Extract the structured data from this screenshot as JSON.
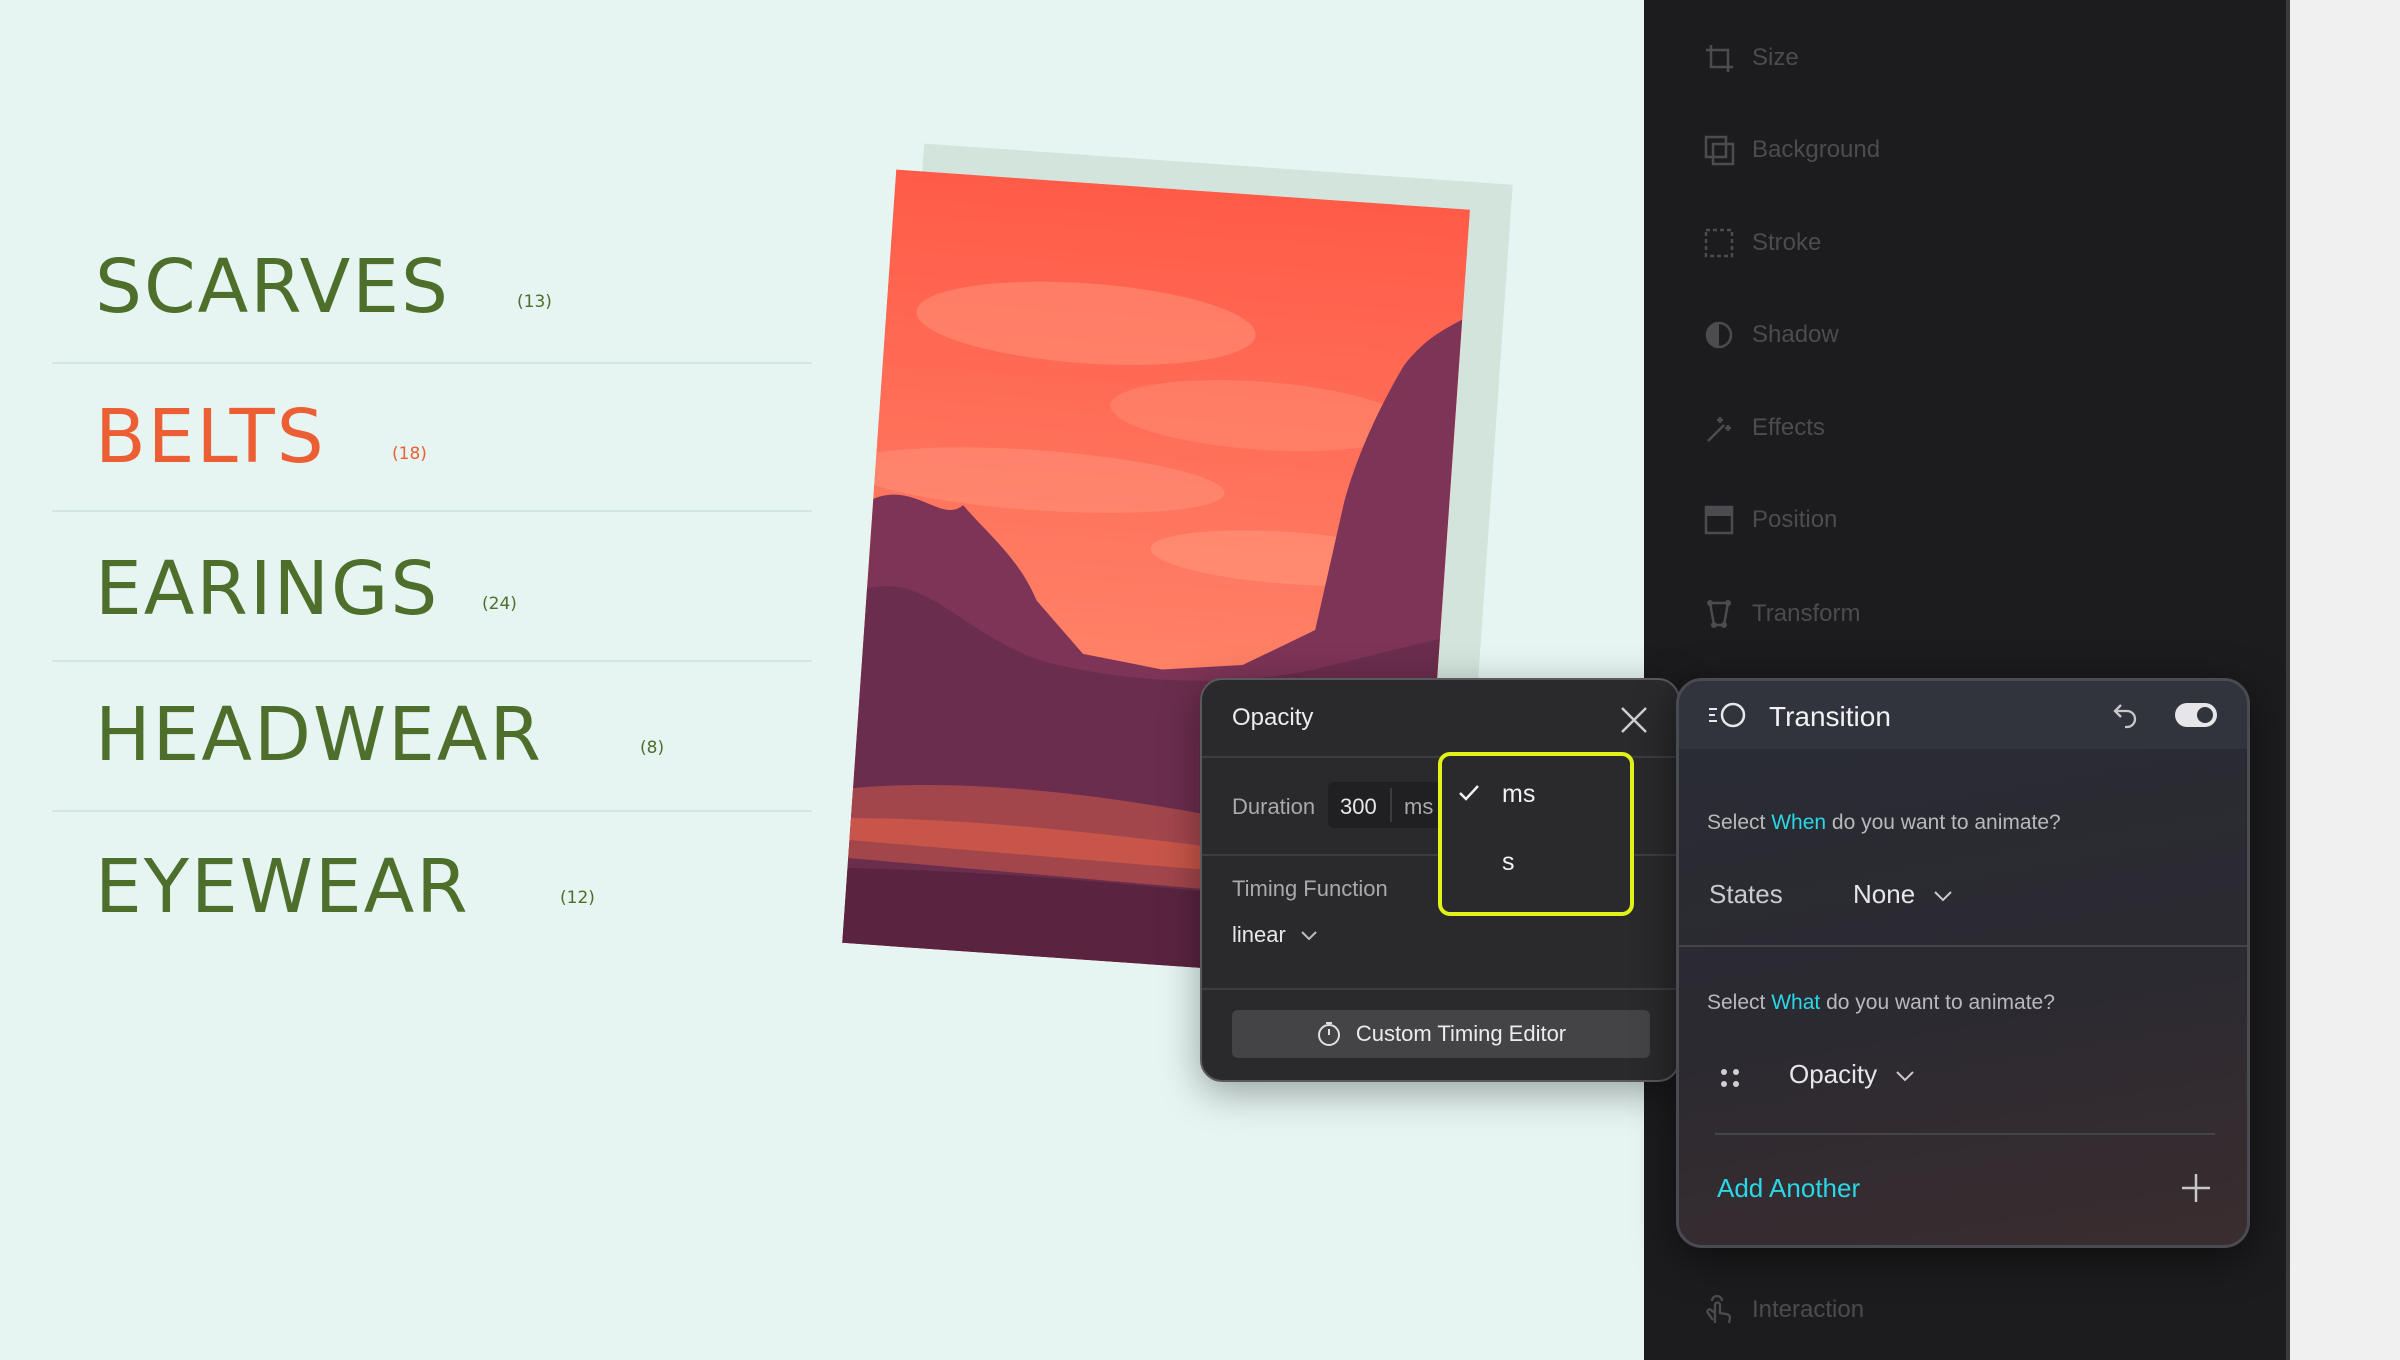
{
  "categories": [
    {
      "name": "SCARVES",
      "count": "(13)",
      "color": "#4e6f2c"
    },
    {
      "name": "BELTS",
      "count": "(18)",
      "color": "#ec5f34"
    },
    {
      "name": "EARINGS",
      "count": "(24)",
      "color": "#4e6f2c"
    },
    {
      "name": "HEADWEAR",
      "count": "(8)",
      "color": "#4e6f2c"
    },
    {
      "name": "EYEWEAR",
      "count": "(12)",
      "color": "#4e6f2c"
    }
  ],
  "opacity_popover": {
    "title": "Opacity",
    "duration_label": "Duration",
    "duration_value": "300",
    "duration_unit": "ms",
    "timing_label": "Timing Function",
    "timing_value": "linear",
    "custom_timing_button": "Custom Timing Editor"
  },
  "unit_dropdown": {
    "options": [
      "ms",
      "s"
    ],
    "selected": "ms",
    "highlight_color": "#e1f21a"
  },
  "properties": [
    "Size",
    "Background",
    "Stroke",
    "Shadow",
    "Effects",
    "Position",
    "Transform",
    "Interaction"
  ],
  "transition": {
    "title": "Transition",
    "when_prefix": "Select",
    "when_accent": "When",
    "when_suffix": "do you want to animate?",
    "states_label": "States",
    "states_value": "None",
    "what_prefix": "Select",
    "what_accent": "What",
    "what_suffix": "do you want to animate?",
    "property_value": "Opacity",
    "add_another": "Add Another",
    "accent_color": "#2ad7e6"
  }
}
